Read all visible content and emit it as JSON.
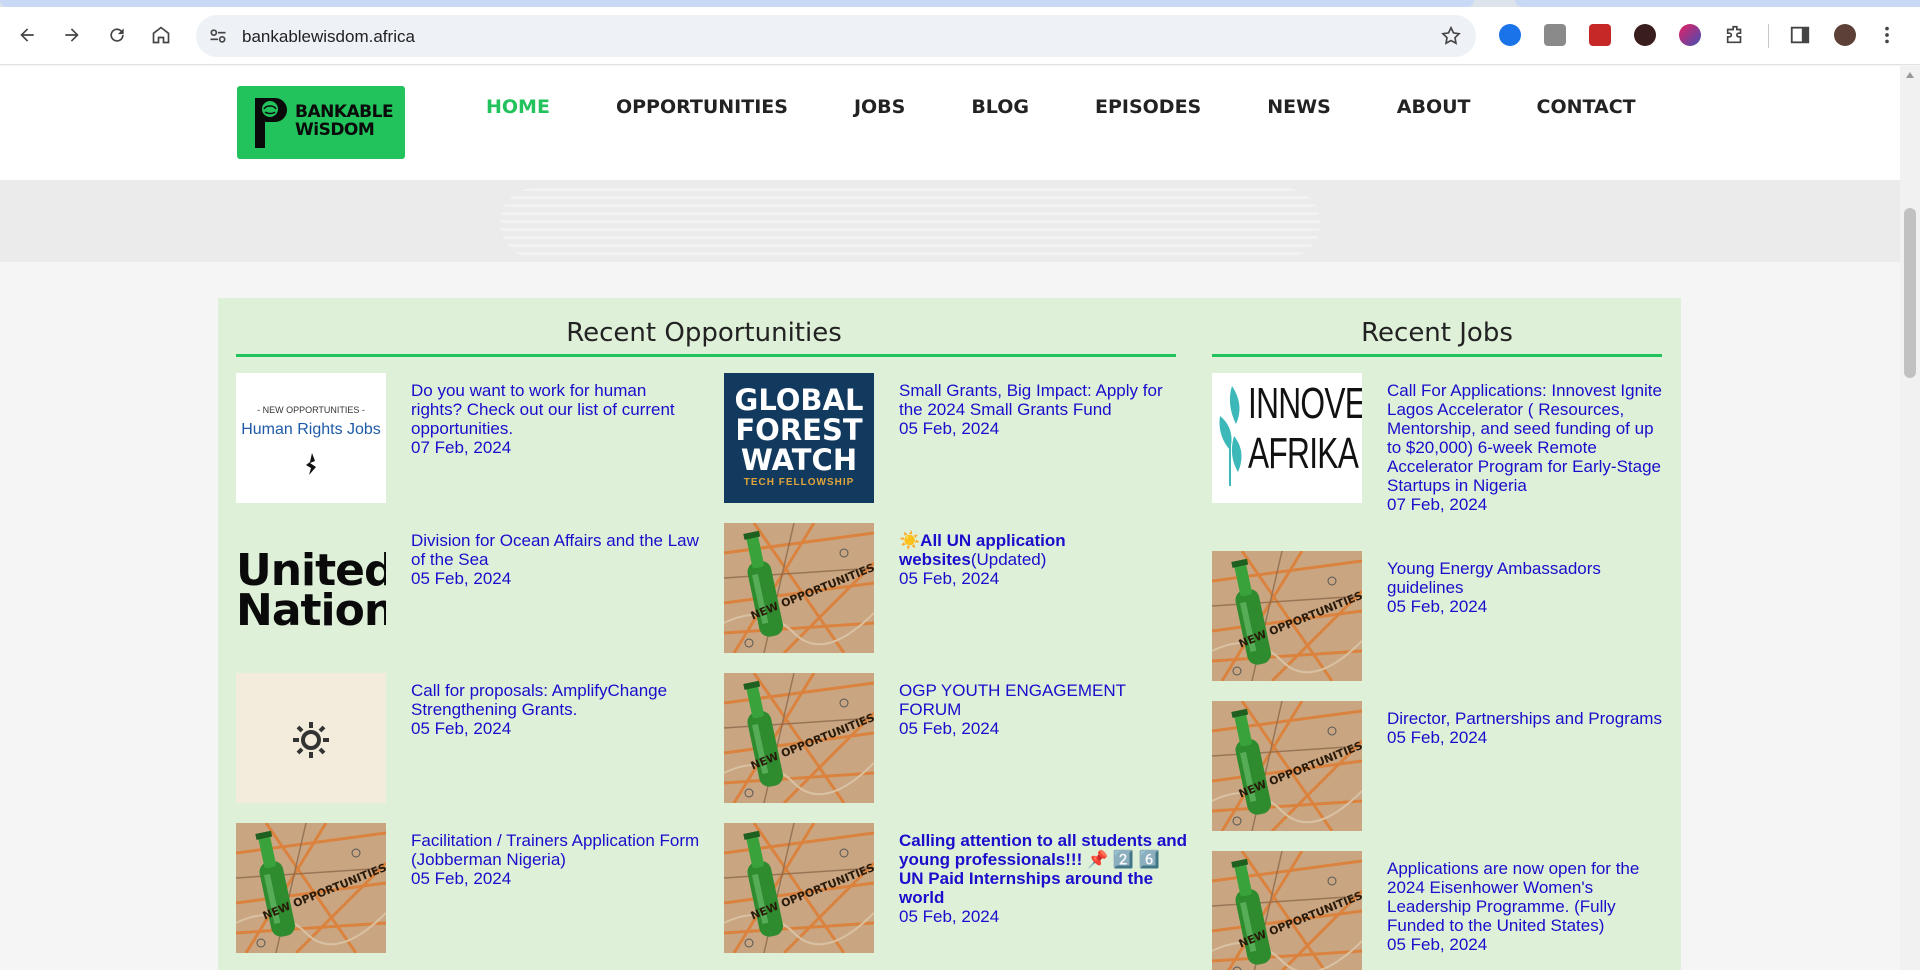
{
  "browser": {
    "url": "bankablewisdom.africa"
  },
  "site": {
    "logo_line1": "BANKABLE",
    "logo_line2": "WiSDOM",
    "nav": [
      {
        "label": "HOME",
        "active": true
      },
      {
        "label": "OPPORTUNITIES",
        "active": false
      },
      {
        "label": "JOBS",
        "active": false
      },
      {
        "label": "BLOG",
        "active": false
      },
      {
        "label": "EPISODES",
        "active": false
      },
      {
        "label": "NEWS",
        "active": false
      },
      {
        "label": "ABOUT",
        "active": false
      },
      {
        "label": "CONTACT",
        "active": false
      }
    ]
  },
  "colors": {
    "accent": "#22c25c",
    "panel": "#dff0d8",
    "link": "#1a0dcc"
  },
  "opportunities": {
    "title": "Recent Opportunities",
    "items": [
      {
        "title": "Do you want to work for human rights? Check out our list of current opportunities.",
        "date": "07 Feb, 2024",
        "thumb": "human-rights",
        "thumb_small": "- NEW OPPORTUNITIES -",
        "thumb_big": "Human Rights Jobs"
      },
      {
        "title": "Small Grants, Big Impact: Apply for the 2024 Small Grants Fund",
        "date": "05 Feb, 2024",
        "thumb": "global-forest-watch",
        "thumb_l1": "GLOBAL",
        "thumb_l2": "FOREST",
        "thumb_l3": "WATCH",
        "thumb_sub": "TECH FELLOWSHIP"
      },
      {
        "title": "Division for Ocean Affairs and the Law of the Sea",
        "date": "05 Feb, 2024",
        "thumb": "united-nations",
        "thumb_l1": "United",
        "thumb_l2": "Nations"
      },
      {
        "title_prefix": "☀️",
        "title": "All UN application websites",
        "title_suffix": "(Updated)",
        "date": "05 Feb, 2024",
        "thumb": "new-opportunities"
      },
      {
        "title": "Call for proposals: AmplifyChange Strengthening Grants.",
        "date": "05 Feb, 2024",
        "thumb": "amplifychange"
      },
      {
        "title": "OGP YOUTH ENGAGEMENT FORUM",
        "date": "05 Feb, 2024",
        "thumb": "new-opportunities"
      },
      {
        "title": "Facilitation / Trainers Application Form (Jobberman Nigeria)",
        "date": "05 Feb, 2024",
        "thumb": "new-opportunities"
      },
      {
        "title": "Calling attention to all students and young professionals!!! 📌 2️⃣ 6️⃣ UN Paid Internships around the world",
        "date": "05 Feb, 2024",
        "thumb": "new-opportunities"
      }
    ]
  },
  "jobs": {
    "title": "Recent Jobs",
    "items": [
      {
        "title": "Call For Applications: Innovest Ignite Lagos Accelerator ( Resources, Mentorship, and seed funding of up to $20,000) 6-week Remote Accelerator Program for Early-Stage Startups in Nigeria",
        "date": "07 Feb, 2024",
        "thumb": "innovest",
        "thumb_l1": "INNOVEST",
        "thumb_l2": "AFRIKA"
      },
      {
        "title": "Young Energy Ambassadors guidelines",
        "date": "05 Feb, 2024",
        "thumb": "new-opportunities"
      },
      {
        "title": "Director, Partnerships and Programs",
        "date": "05 Feb, 2024",
        "thumb": "new-opportunities"
      },
      {
        "title": "Applications are now open for the 2024 Eisenhower Women's Leadership Programme. (Fully Funded to the United States)",
        "date": "05 Feb, 2024",
        "thumb": "new-opportunities"
      }
    ]
  },
  "thumb_caption": "NEW OPPORTUNITIES"
}
